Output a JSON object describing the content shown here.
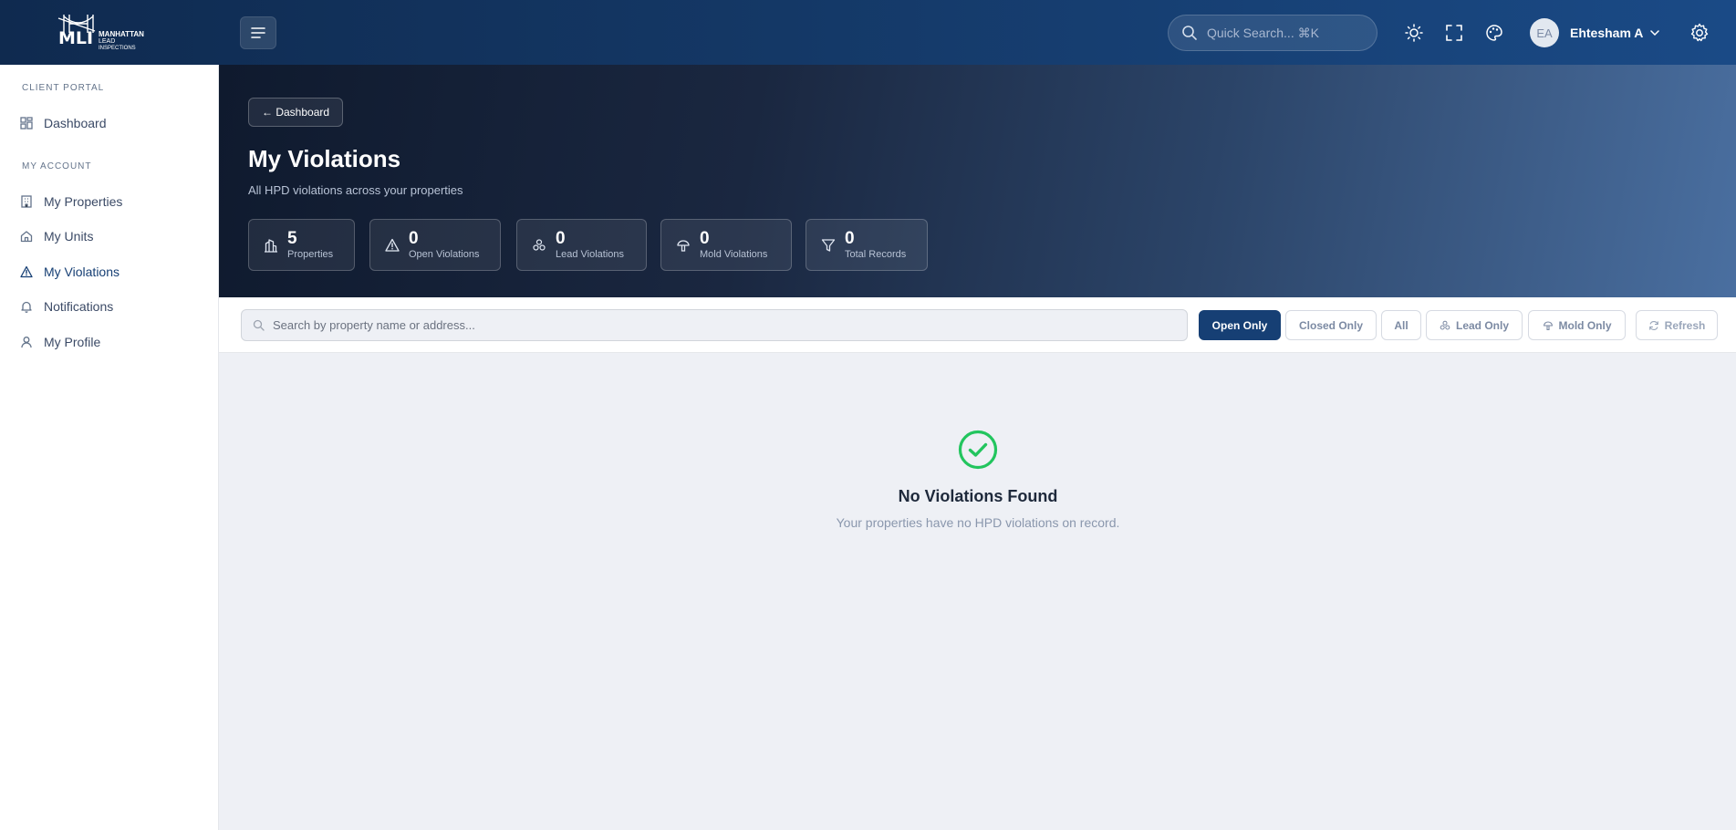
{
  "brand": {
    "logo_mark": "MLI",
    "logo_line1": "MANHATTAN",
    "logo_line2": "LEAD",
    "logo_line3": "INSPECTIONS"
  },
  "topbar": {
    "search_placeholder": "Quick Search... ⌘K",
    "user_initials": "EA",
    "user_name": "Ehtesham A",
    "icons": [
      "menu-icon",
      "sun-icon",
      "fullscreen-icon",
      "palette-icon",
      "chevron-down-icon",
      "settings-icon"
    ]
  },
  "sidebar": {
    "section_portal": "CLIENT PORTAL",
    "section_account": "MY ACCOUNT",
    "items": [
      {
        "label": "Dashboard",
        "icon": "dashboard-icon"
      },
      {
        "label": "My Properties",
        "icon": "building-icon"
      },
      {
        "label": "My Units",
        "icon": "home-icon"
      },
      {
        "label": "My Violations",
        "icon": "warning-icon",
        "active": true
      },
      {
        "label": "Notifications",
        "icon": "bell-icon"
      },
      {
        "label": "My Profile",
        "icon": "user-icon"
      }
    ]
  },
  "hero": {
    "back_label": "← Dashboard",
    "title": "My Violations",
    "subtitle": "All HPD violations across your properties",
    "stats": [
      {
        "value": "5",
        "label": "Properties",
        "icon": "building-icon"
      },
      {
        "value": "0",
        "label": "Open Violations",
        "icon": "warning-icon"
      },
      {
        "value": "0",
        "label": "Lead Violations",
        "icon": "biohazard-icon"
      },
      {
        "value": "0",
        "label": "Mold Violations",
        "icon": "mushroom-icon"
      },
      {
        "value": "0",
        "label": "Total Records",
        "icon": "filter-icon"
      }
    ]
  },
  "filters": {
    "search_placeholder": "Search by property name or address...",
    "open_only": "Open Only",
    "closed_only": "Closed Only",
    "all": "All",
    "lead_only": "Lead Only",
    "mold_only": "Mold Only",
    "refresh": "Refresh"
  },
  "empty": {
    "title": "No Violations Found",
    "subtitle": "Your properties have no HPD violations on record."
  },
  "colors": {
    "accent": "#163f74",
    "success": "#22c55e"
  }
}
